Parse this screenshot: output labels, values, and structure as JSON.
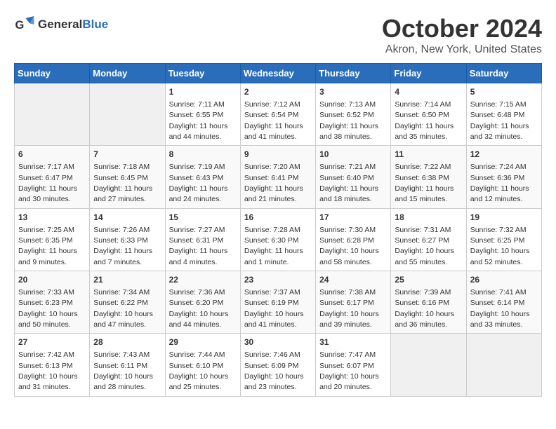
{
  "header": {
    "logo_general": "General",
    "logo_blue": "Blue",
    "month": "October 2024",
    "location": "Akron, New York, United States"
  },
  "weekdays": [
    "Sunday",
    "Monday",
    "Tuesday",
    "Wednesday",
    "Thursday",
    "Friday",
    "Saturday"
  ],
  "weeks": [
    [
      {
        "day": "",
        "empty": true
      },
      {
        "day": "",
        "empty": true
      },
      {
        "day": "1",
        "sunrise": "Sunrise: 7:11 AM",
        "sunset": "Sunset: 6:55 PM",
        "daylight": "Daylight: 11 hours and 44 minutes."
      },
      {
        "day": "2",
        "sunrise": "Sunrise: 7:12 AM",
        "sunset": "Sunset: 6:54 PM",
        "daylight": "Daylight: 11 hours and 41 minutes."
      },
      {
        "day": "3",
        "sunrise": "Sunrise: 7:13 AM",
        "sunset": "Sunset: 6:52 PM",
        "daylight": "Daylight: 11 hours and 38 minutes."
      },
      {
        "day": "4",
        "sunrise": "Sunrise: 7:14 AM",
        "sunset": "Sunset: 6:50 PM",
        "daylight": "Daylight: 11 hours and 35 minutes."
      },
      {
        "day": "5",
        "sunrise": "Sunrise: 7:15 AM",
        "sunset": "Sunset: 6:48 PM",
        "daylight": "Daylight: 11 hours and 32 minutes."
      }
    ],
    [
      {
        "day": "6",
        "sunrise": "Sunrise: 7:17 AM",
        "sunset": "Sunset: 6:47 PM",
        "daylight": "Daylight: 11 hours and 30 minutes."
      },
      {
        "day": "7",
        "sunrise": "Sunrise: 7:18 AM",
        "sunset": "Sunset: 6:45 PM",
        "daylight": "Daylight: 11 hours and 27 minutes."
      },
      {
        "day": "8",
        "sunrise": "Sunrise: 7:19 AM",
        "sunset": "Sunset: 6:43 PM",
        "daylight": "Daylight: 11 hours and 24 minutes."
      },
      {
        "day": "9",
        "sunrise": "Sunrise: 7:20 AM",
        "sunset": "Sunset: 6:41 PM",
        "daylight": "Daylight: 11 hours and 21 minutes."
      },
      {
        "day": "10",
        "sunrise": "Sunrise: 7:21 AM",
        "sunset": "Sunset: 6:40 PM",
        "daylight": "Daylight: 11 hours and 18 minutes."
      },
      {
        "day": "11",
        "sunrise": "Sunrise: 7:22 AM",
        "sunset": "Sunset: 6:38 PM",
        "daylight": "Daylight: 11 hours and 15 minutes."
      },
      {
        "day": "12",
        "sunrise": "Sunrise: 7:24 AM",
        "sunset": "Sunset: 6:36 PM",
        "daylight": "Daylight: 11 hours and 12 minutes."
      }
    ],
    [
      {
        "day": "13",
        "sunrise": "Sunrise: 7:25 AM",
        "sunset": "Sunset: 6:35 PM",
        "daylight": "Daylight: 11 hours and 9 minutes."
      },
      {
        "day": "14",
        "sunrise": "Sunrise: 7:26 AM",
        "sunset": "Sunset: 6:33 PM",
        "daylight": "Daylight: 11 hours and 7 minutes."
      },
      {
        "day": "15",
        "sunrise": "Sunrise: 7:27 AM",
        "sunset": "Sunset: 6:31 PM",
        "daylight": "Daylight: 11 hours and 4 minutes."
      },
      {
        "day": "16",
        "sunrise": "Sunrise: 7:28 AM",
        "sunset": "Sunset: 6:30 PM",
        "daylight": "Daylight: 11 hours and 1 minute."
      },
      {
        "day": "17",
        "sunrise": "Sunrise: 7:30 AM",
        "sunset": "Sunset: 6:28 PM",
        "daylight": "Daylight: 10 hours and 58 minutes."
      },
      {
        "day": "18",
        "sunrise": "Sunrise: 7:31 AM",
        "sunset": "Sunset: 6:27 PM",
        "daylight": "Daylight: 10 hours and 55 minutes."
      },
      {
        "day": "19",
        "sunrise": "Sunrise: 7:32 AM",
        "sunset": "Sunset: 6:25 PM",
        "daylight": "Daylight: 10 hours and 52 minutes."
      }
    ],
    [
      {
        "day": "20",
        "sunrise": "Sunrise: 7:33 AM",
        "sunset": "Sunset: 6:23 PM",
        "daylight": "Daylight: 10 hours and 50 minutes."
      },
      {
        "day": "21",
        "sunrise": "Sunrise: 7:34 AM",
        "sunset": "Sunset: 6:22 PM",
        "daylight": "Daylight: 10 hours and 47 minutes."
      },
      {
        "day": "22",
        "sunrise": "Sunrise: 7:36 AM",
        "sunset": "Sunset: 6:20 PM",
        "daylight": "Daylight: 10 hours and 44 minutes."
      },
      {
        "day": "23",
        "sunrise": "Sunrise: 7:37 AM",
        "sunset": "Sunset: 6:19 PM",
        "daylight": "Daylight: 10 hours and 41 minutes."
      },
      {
        "day": "24",
        "sunrise": "Sunrise: 7:38 AM",
        "sunset": "Sunset: 6:17 PM",
        "daylight": "Daylight: 10 hours and 39 minutes."
      },
      {
        "day": "25",
        "sunrise": "Sunrise: 7:39 AM",
        "sunset": "Sunset: 6:16 PM",
        "daylight": "Daylight: 10 hours and 36 minutes."
      },
      {
        "day": "26",
        "sunrise": "Sunrise: 7:41 AM",
        "sunset": "Sunset: 6:14 PM",
        "daylight": "Daylight: 10 hours and 33 minutes."
      }
    ],
    [
      {
        "day": "27",
        "sunrise": "Sunrise: 7:42 AM",
        "sunset": "Sunset: 6:13 PM",
        "daylight": "Daylight: 10 hours and 31 minutes."
      },
      {
        "day": "28",
        "sunrise": "Sunrise: 7:43 AM",
        "sunset": "Sunset: 6:11 PM",
        "daylight": "Daylight: 10 hours and 28 minutes."
      },
      {
        "day": "29",
        "sunrise": "Sunrise: 7:44 AM",
        "sunset": "Sunset: 6:10 PM",
        "daylight": "Daylight: 10 hours and 25 minutes."
      },
      {
        "day": "30",
        "sunrise": "Sunrise: 7:46 AM",
        "sunset": "Sunset: 6:09 PM",
        "daylight": "Daylight: 10 hours and 23 minutes."
      },
      {
        "day": "31",
        "sunrise": "Sunrise: 7:47 AM",
        "sunset": "Sunset: 6:07 PM",
        "daylight": "Daylight: 10 hours and 20 minutes."
      },
      {
        "day": "",
        "empty": true
      },
      {
        "day": "",
        "empty": true
      }
    ]
  ]
}
